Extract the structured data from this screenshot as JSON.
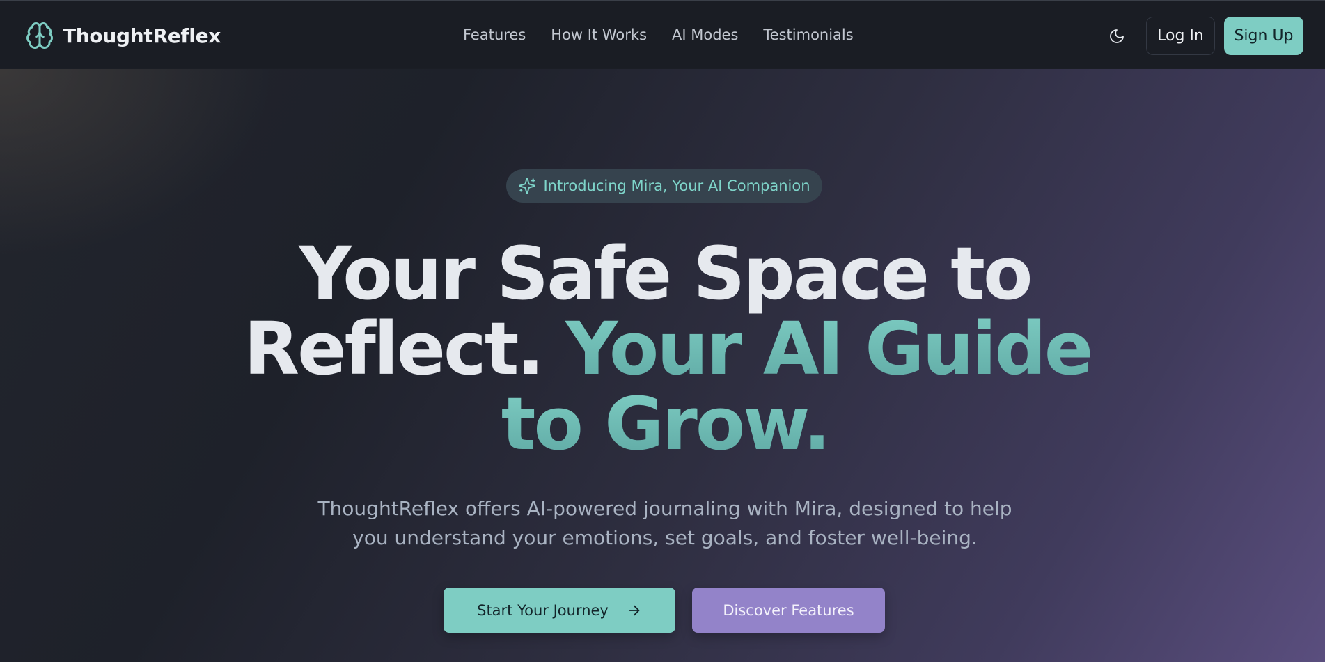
{
  "brand": {
    "name": "ThoughtReflex",
    "icon": "brain-icon",
    "accent": "#7ecdc3"
  },
  "nav": {
    "links": [
      "Features",
      "How It Works",
      "AI Modes",
      "Testimonials"
    ],
    "theme_toggle_icon": "moon-icon",
    "login_label": "Log In",
    "signup_label": "Sign Up"
  },
  "hero": {
    "badge": {
      "icon": "sparkles-icon",
      "text": "Introducing Mira, Your AI Companion"
    },
    "headline": {
      "line1": "Your Safe Space to",
      "line2_white": "Reflect. ",
      "line2_teal": "Your AI Guide",
      "line3_teal": "to Grow."
    },
    "subtext": "ThoughtReflex offers AI-powered journaling with Mira, designed to help you understand your emotions, set goals, and foster well-being.",
    "primary_cta": {
      "label": "Start Your Journey",
      "icon": "arrow-right-icon",
      "color": "#7ecdc3"
    },
    "secondary_cta": {
      "label": "Discover Features",
      "color": "#9383c9"
    }
  }
}
